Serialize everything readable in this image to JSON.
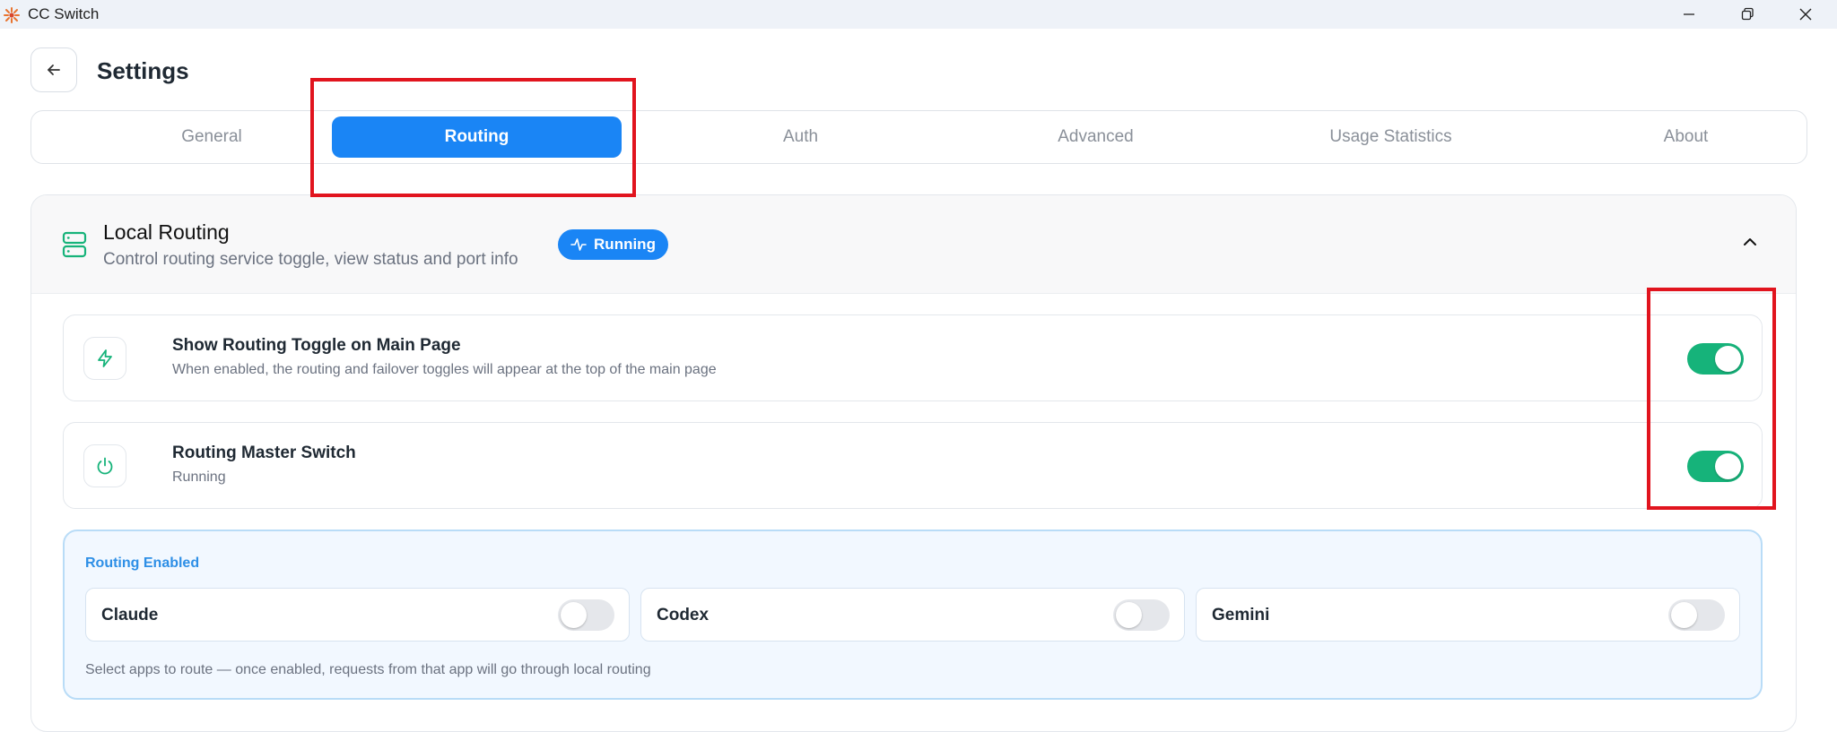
{
  "window": {
    "title": "CC Switch"
  },
  "header": {
    "page_title": "Settings"
  },
  "tabs": [
    {
      "label": "General",
      "active": false
    },
    {
      "label": "Routing",
      "active": true
    },
    {
      "label": "Auth",
      "active": false
    },
    {
      "label": "Advanced",
      "active": false
    },
    {
      "label": "Usage Statistics",
      "active": false
    },
    {
      "label": "About",
      "active": false
    }
  ],
  "section": {
    "title": "Local Routing",
    "subtitle": "Control routing service toggle, view status and port info",
    "status_badge": "Running",
    "expanded": true
  },
  "settings": [
    {
      "title": "Show Routing Toggle on Main Page",
      "subtitle": "When enabled, the routing and failover toggles will appear at the top of the main page",
      "enabled": true
    },
    {
      "title": "Routing Master Switch",
      "subtitle": "Running",
      "enabled": true
    }
  ],
  "routing_enabled": {
    "label": "Routing Enabled",
    "apps": [
      {
        "name": "Claude",
        "enabled": false
      },
      {
        "name": "Codex",
        "enabled": false
      },
      {
        "name": "Gemini",
        "enabled": false
      }
    ],
    "footer": "Select apps to route — once enabled, requests from that app will go through local routing"
  },
  "colors": {
    "accent": "#1a85f5",
    "toggle_on": "#16b37a",
    "highlight": "#e1141e"
  }
}
